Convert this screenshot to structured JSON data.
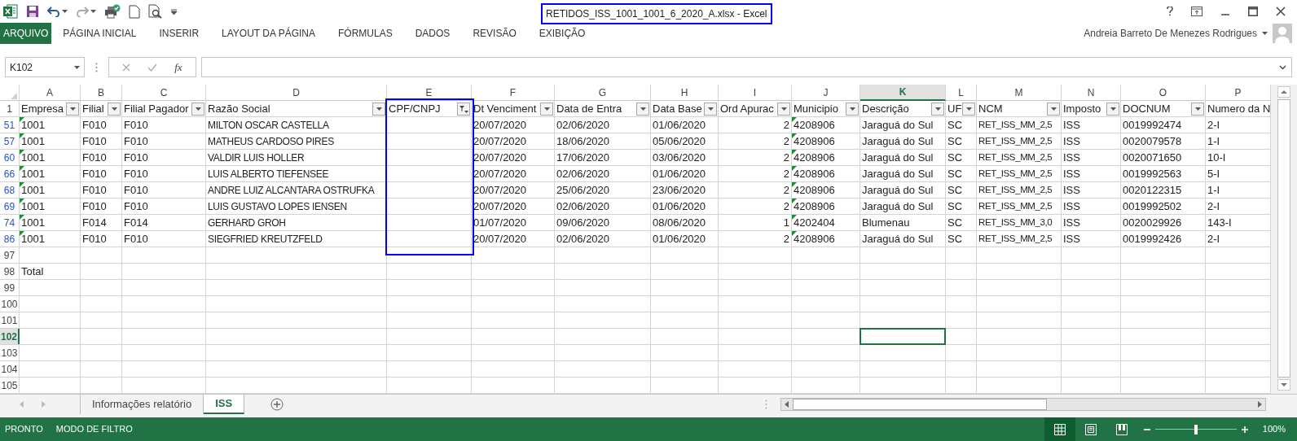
{
  "window": {
    "title": "RETIDOS_ISS_1001_1001_6_2020_A.xlsx - Excel",
    "title_highlighted": true,
    "user": "Andreia Barreto De Menezes Rodrigues"
  },
  "ribbon_tabs": [
    {
      "label": "ARQUIVO",
      "kind": "file"
    },
    {
      "label": "PÁGINA INICIAL",
      "kind": "tab"
    },
    {
      "label": "INSERIR",
      "kind": "tab"
    },
    {
      "label": "LAYOUT DA PÁGINA",
      "kind": "tab"
    },
    {
      "label": "FÓRMULAS",
      "kind": "tab"
    },
    {
      "label": "DADOS",
      "kind": "tab"
    },
    {
      "label": "REVISÃO",
      "kind": "tab"
    },
    {
      "label": "EXIBIÇÃO",
      "kind": "tab"
    }
  ],
  "formula_bar": {
    "name_box": "K102",
    "function_label": "fx"
  },
  "columns": [
    {
      "letter": "A",
      "selected": false,
      "text_number": true
    },
    {
      "letter": "B",
      "selected": false
    },
    {
      "letter": "C",
      "selected": false
    },
    {
      "letter": "D",
      "selected": false
    },
    {
      "letter": "E",
      "selected": false,
      "highlighted": true
    },
    {
      "letter": "F",
      "selected": false
    },
    {
      "letter": "G",
      "selected": false
    },
    {
      "letter": "H",
      "selected": false
    },
    {
      "letter": "I",
      "selected": false,
      "numeric": true
    },
    {
      "letter": "J",
      "selected": false,
      "text_number": true
    },
    {
      "letter": "K",
      "selected": true
    },
    {
      "letter": "L",
      "selected": false
    },
    {
      "letter": "M",
      "selected": false
    },
    {
      "letter": "N",
      "selected": false
    },
    {
      "letter": "O",
      "selected": false
    },
    {
      "letter": "P",
      "selected": false
    }
  ],
  "header_row": {
    "number": "1",
    "cells": [
      {
        "text": "Empresa",
        "filter_button": true,
        "filtered": false
      },
      {
        "text": "Filial",
        "filter_button": true,
        "filtered": false
      },
      {
        "text": "Filial Pagador",
        "filter_button": true,
        "filtered": false
      },
      {
        "text": "Razão Social",
        "filter_button": true,
        "filtered": false
      },
      {
        "text": "CPF/CNPJ",
        "filter_button": true,
        "filtered": true
      },
      {
        "text": "Dt Venciment",
        "filter_button": true,
        "filtered": false
      },
      {
        "text": "Data de Entra",
        "filter_button": true,
        "filtered": false
      },
      {
        "text": "Data Base",
        "filter_button": true,
        "filtered": false
      },
      {
        "text": "Ord Apurac",
        "filter_button": true,
        "filtered": false
      },
      {
        "text": "Municipio",
        "filter_button": true,
        "filtered": false
      },
      {
        "text": "Descrição",
        "filter_button": true,
        "filtered": false
      },
      {
        "text": "UF",
        "filter_button": true,
        "filtered": false
      },
      {
        "text": "NCM",
        "filter_button": true,
        "filtered": false
      },
      {
        "text": "Imposto",
        "filter_button": true,
        "filtered": false
      },
      {
        "text": "DOCNUM",
        "filter_button": true,
        "filtered": false
      },
      {
        "text": "Numero da N"
      }
    ]
  },
  "rows": [
    {
      "number": "51",
      "filtered": true,
      "selected": false,
      "flagged": true,
      "cells": {
        "A": "1001",
        "B": "F010",
        "C": "F010",
        "D": "MILTON OSCAR CASTELLA",
        "F": "20/07/2020",
        "G": "02/06/2020",
        "H": "01/06/2020",
        "I": "2",
        "J": "4208906",
        "K": "Jaraguá do Sul",
        "L": "SC",
        "M": "RET_ISS_MM_2,5",
        "N": "ISS",
        "O": "0019992474",
        "P": "2-I"
      }
    },
    {
      "number": "57",
      "filtered": true,
      "selected": false,
      "flagged": true,
      "cells": {
        "A": "1001",
        "B": "F010",
        "C": "F010",
        "D": "MATHEUS CARDOSO PIRES",
        "F": "20/07/2020",
        "G": "18/06/2020",
        "H": "05/06/2020",
        "I": "2",
        "J": "4208906",
        "K": "Jaraguá do Sul",
        "L": "SC",
        "M": "RET_ISS_MM_2,5",
        "N": "ISS",
        "O": "0020079578",
        "P": "1-I"
      }
    },
    {
      "number": "60",
      "filtered": true,
      "selected": false,
      "flagged": true,
      "cells": {
        "A": "1001",
        "B": "F010",
        "C": "F010",
        "D": "VALDIR LUIS HOLLER",
        "F": "20/07/2020",
        "G": "17/06/2020",
        "H": "03/06/2020",
        "I": "2",
        "J": "4208906",
        "K": "Jaraguá do Sul",
        "L": "SC",
        "M": "RET_ISS_MM_2,5",
        "N": "ISS",
        "O": "0020071650",
        "P": "10-I"
      }
    },
    {
      "number": "66",
      "filtered": true,
      "selected": false,
      "flagged": true,
      "cells": {
        "A": "1001",
        "B": "F010",
        "C": "F010",
        "D": "LUIS ALBERTO TIEFENSEE",
        "F": "20/07/2020",
        "G": "02/06/2020",
        "H": "01/06/2020",
        "I": "2",
        "J": "4208906",
        "K": "Jaraguá do Sul",
        "L": "SC",
        "M": "RET_ISS_MM_2,5",
        "N": "ISS",
        "O": "0019992563",
        "P": "5-I"
      }
    },
    {
      "number": "68",
      "filtered": true,
      "selected": false,
      "flagged": true,
      "cells": {
        "A": "1001",
        "B": "F010",
        "C": "F010",
        "D": "ANDRE LUIZ ALCANTARA OSTRUFKA",
        "F": "20/07/2020",
        "G": "25/06/2020",
        "H": "23/06/2020",
        "I": "2",
        "J": "4208906",
        "K": "Jaraguá do Sul",
        "L": "SC",
        "M": "RET_ISS_MM_2,5",
        "N": "ISS",
        "O": "0020122315",
        "P": "1-I"
      }
    },
    {
      "number": "69",
      "filtered": true,
      "selected": false,
      "flagged": true,
      "cells": {
        "A": "1001",
        "B": "F010",
        "C": "F010",
        "D": "LUIS GUSTAVO LOPES IENSEN",
        "F": "20/07/2020",
        "G": "02/06/2020",
        "H": "01/06/2020",
        "I": "2",
        "J": "4208906",
        "K": "Jaraguá do Sul",
        "L": "SC",
        "M": "RET_ISS_MM_2,5",
        "N": "ISS",
        "O": "0019992502",
        "P": "2-I"
      }
    },
    {
      "number": "74",
      "filtered": true,
      "selected": false,
      "flagged": true,
      "cells": {
        "A": "1001",
        "B": "F014",
        "C": "F014",
        "D": "GERHARD GROH",
        "F": "01/07/2020",
        "G": "09/06/2020",
        "H": "08/06/2020",
        "I": "1",
        "J": "4202404",
        "K": "Blumenau",
        "L": "SC",
        "M": "RET_ISS_MM_3,0",
        "N": "ISS",
        "O": "0020029926",
        "P": "143-I"
      }
    },
    {
      "number": "86",
      "filtered": true,
      "selected": false,
      "flagged": true,
      "cells": {
        "A": "1001",
        "B": "F010",
        "C": "F010",
        "D": "SIEGFRIED KREUTZFELD",
        "F": "20/07/2020",
        "G": "02/06/2020",
        "H": "01/06/2020",
        "I": "2",
        "J": "4208906",
        "K": "Jaraguá do Sul",
        "L": "SC",
        "M": "RET_ISS_MM_2,5",
        "N": "ISS",
        "O": "0019992426",
        "P": "2-I"
      }
    },
    {
      "number": "97",
      "filtered": false,
      "selected": false
    },
    {
      "number": "98",
      "filtered": false,
      "selected": false,
      "cells": {
        "A": "Total"
      }
    },
    {
      "number": "99",
      "filtered": false,
      "selected": false
    },
    {
      "number": "100",
      "filtered": false,
      "selected": false
    },
    {
      "number": "101",
      "filtered": false,
      "selected": false
    },
    {
      "number": "102",
      "filtered": false,
      "selected": true
    },
    {
      "number": "103",
      "filtered": false,
      "selected": false
    },
    {
      "number": "104",
      "filtered": false,
      "selected": false
    },
    {
      "number": "105",
      "filtered": false,
      "selected": false
    }
  ],
  "sheet_tabs": [
    {
      "label": "Informações relatório",
      "selected": false
    },
    {
      "label": "ISS",
      "selected": true
    }
  ],
  "status_bar": {
    "items": [
      "PRONTO",
      "MODO DE FILTRO"
    ],
    "views": [
      {
        "kind": "normal",
        "selected": true
      },
      {
        "kind": "page_layout",
        "selected": false
      },
      {
        "kind": "page_break",
        "selected": false
      }
    ],
    "zoom": {
      "level": 0.5,
      "reading": "100%"
    }
  }
}
